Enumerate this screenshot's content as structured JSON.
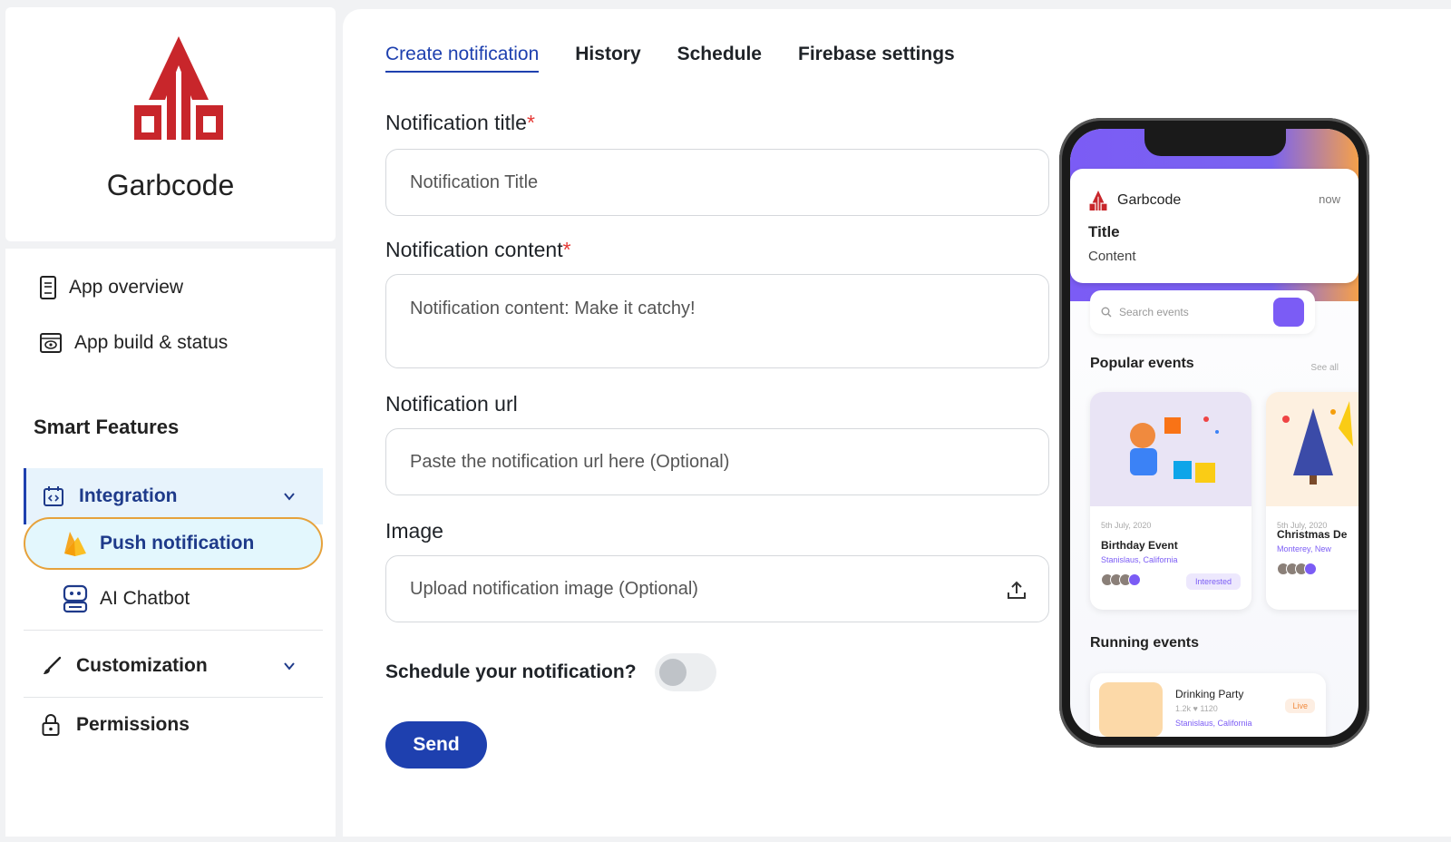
{
  "brand": {
    "name": "Garbcode"
  },
  "sidebar": {
    "items": [
      {
        "label": "App overview",
        "icon": "phone-icon"
      },
      {
        "label": "App build & status",
        "icon": "eye-window-icon"
      }
    ],
    "section_title": "Smart Features",
    "integration": {
      "label": "Integration",
      "children": [
        {
          "label": "Push notification",
          "icon": "firebase-icon"
        },
        {
          "label": "AI Chatbot",
          "icon": "robot-icon"
        }
      ]
    },
    "customization": {
      "label": "Customization"
    },
    "permissions": {
      "label": "Permissions"
    }
  },
  "tabs": [
    {
      "label": "Create notification",
      "active": true
    },
    {
      "label": "History"
    },
    {
      "label": "Schedule"
    },
    {
      "label": "Firebase settings"
    }
  ],
  "form": {
    "title_label": "Notification title",
    "title_placeholder": "Notification Title",
    "content_label": "Notification content",
    "content_placeholder": "Notification content: Make it catchy!",
    "url_label": "Notification url",
    "url_placeholder": "Paste the notification url here (Optional)",
    "image_label": "Image",
    "image_placeholder": "Upload notification image (Optional)",
    "required_mark": "*",
    "schedule_label": "Schedule your notification?",
    "schedule_enabled": false,
    "send_label": "Send"
  },
  "preview": {
    "app": "Garbcode",
    "time": "now",
    "title": "Title",
    "content": "Content",
    "search_placeholder": "Search events",
    "popular_heading": "Popular events",
    "see_all": "See all",
    "events": [
      {
        "date": "5th July, 2020",
        "name": "Birthday Event",
        "location": "Stanislaus, California",
        "tag": "Interested"
      },
      {
        "date": "5th July, 2020",
        "name": "Christmas De",
        "location": "Monterey, New"
      }
    ],
    "running_heading": "Running events",
    "running": {
      "name": "Drinking Party",
      "stats": "1.2k  ♥ 1120",
      "location": "Stanislaus, California",
      "tag": "Live"
    }
  },
  "colors": {
    "accent": "#1e40af",
    "brand_red": "#c8262b",
    "highlight_border": "#e6a23c",
    "preview_purple": "#7b5cf5"
  }
}
